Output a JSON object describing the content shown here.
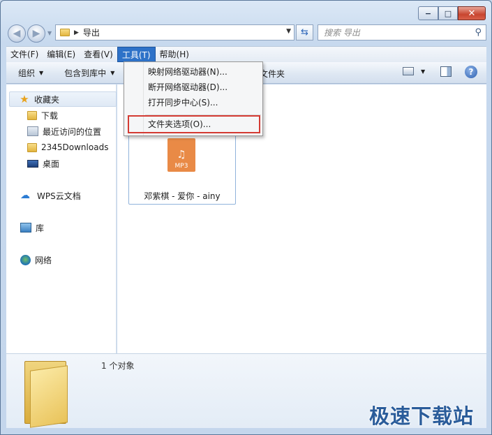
{
  "window": {
    "controls": {
      "minimize": "−",
      "maximize": "□",
      "close": "✕"
    }
  },
  "address": {
    "path": "导出"
  },
  "search": {
    "placeholder": "搜索 导出"
  },
  "menubar": {
    "items": [
      "文件(F)",
      "编辑(E)",
      "查看(V)",
      "工具(T)",
      "帮助(H)"
    ],
    "active_index": 3
  },
  "commandbar": {
    "organize": "组织",
    "include_library": "包含到库中",
    "partial": "文件夹"
  },
  "tools_menu": {
    "items": [
      "映射网络驱动器(N)...",
      "断开网络驱动器(D)...",
      "打开同步中心(S)...",
      "文件夹选项(O)..."
    ],
    "highlighted": "文件夹选项(O)..."
  },
  "navpane": {
    "favorites": "收藏夹",
    "favorite_items": [
      "下载",
      "最近访问的位置",
      "2345Downloads",
      "桌面"
    ],
    "wps": "WPS云文档",
    "libraries": "库",
    "network": "网络"
  },
  "file": {
    "name": "邓紫棋 - 爱你 - ainy",
    "type_label": "MP3"
  },
  "details": {
    "count": "1 个对象"
  },
  "watermark": "极速下载站",
  "colors": {
    "highlight_box": "#d43b33",
    "menu_active": "#2e72c8",
    "mp3": "#e98a46"
  }
}
